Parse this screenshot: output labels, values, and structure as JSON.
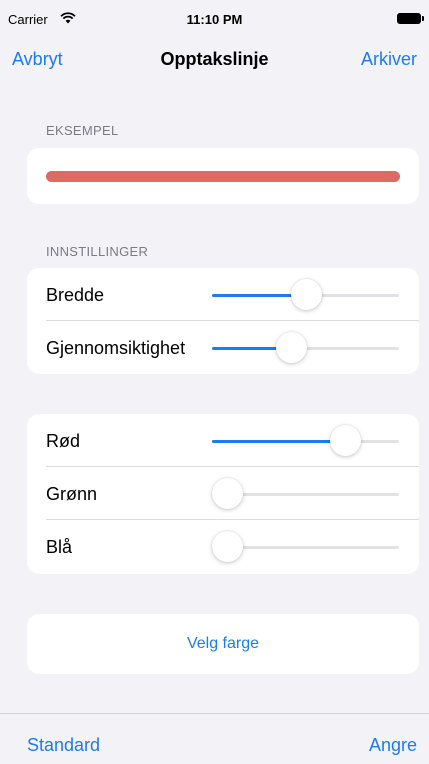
{
  "status_bar": {
    "carrier": "Carrier",
    "time": "11:10 PM",
    "icons": [
      "wifi-icon",
      "battery-icon"
    ]
  },
  "nav": {
    "cancel": "Avbryt",
    "title": "Opptakslinje",
    "archive": "Arkiver"
  },
  "example": {
    "header": "EKSEMPEL",
    "line_color": "#de6a64"
  },
  "settings": {
    "header": "INNSTILLINGER",
    "sliders": [
      {
        "label": "Bredde",
        "value": 0.5
      },
      {
        "label": "Gjennomsiktighet",
        "value": 0.41
      }
    ]
  },
  "color": {
    "sliders": [
      {
        "label": "Rød",
        "value": 0.75
      },
      {
        "label": "Grønn",
        "value": 0.0
      },
      {
        "label": "Blå",
        "value": 0.0
      }
    ]
  },
  "pick_color_button": "Velg farge",
  "toolbar": {
    "default": "Standard",
    "undo": "Angre"
  },
  "colors": {
    "accent": "#1d7bf1",
    "background": "#f2f2f7",
    "track": "#e2e2e6"
  }
}
